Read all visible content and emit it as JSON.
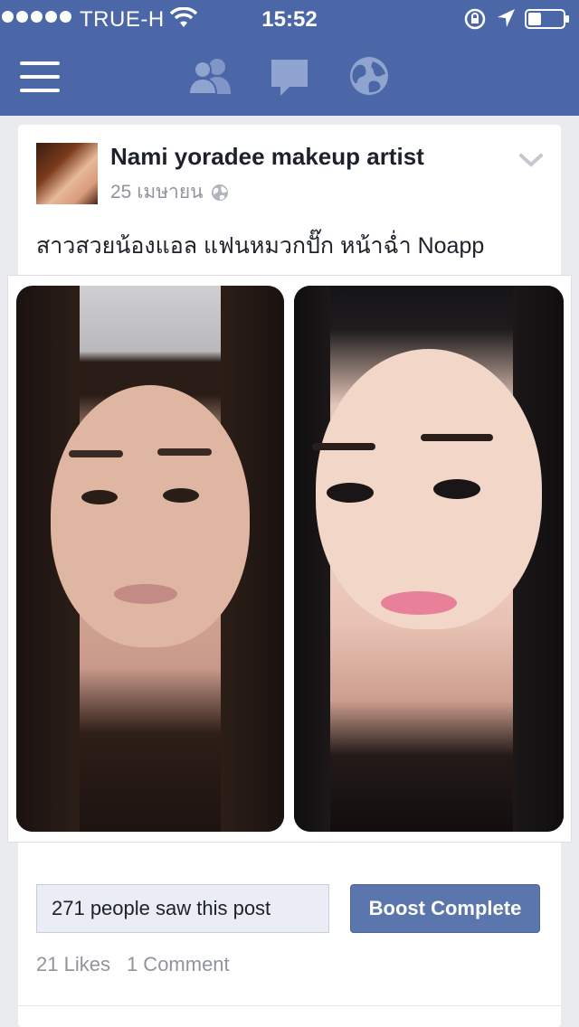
{
  "status_bar": {
    "carrier": "TRUE-H",
    "time": "15:52"
  },
  "nav": {
    "icons": [
      "menu-icon",
      "friend-requests-icon",
      "messages-icon",
      "notifications-globe-icon"
    ]
  },
  "post": {
    "author": "Nami yoradee makeup artist",
    "date": "25 เมษายน",
    "text": "สาวสวยน้องแอล แฟนหมวกปั๊ก หน้าฉ่ำ Noapp",
    "photo_alt": "before and after makeup comparison",
    "reach": "271 people saw this post",
    "boost_label": "Boost Complete",
    "likes": "21 Likes",
    "comments": "1 Comment"
  },
  "colors": {
    "brand": "#4b67a7",
    "boost_button": "#5b76ac",
    "muted_text": "#90949c"
  }
}
